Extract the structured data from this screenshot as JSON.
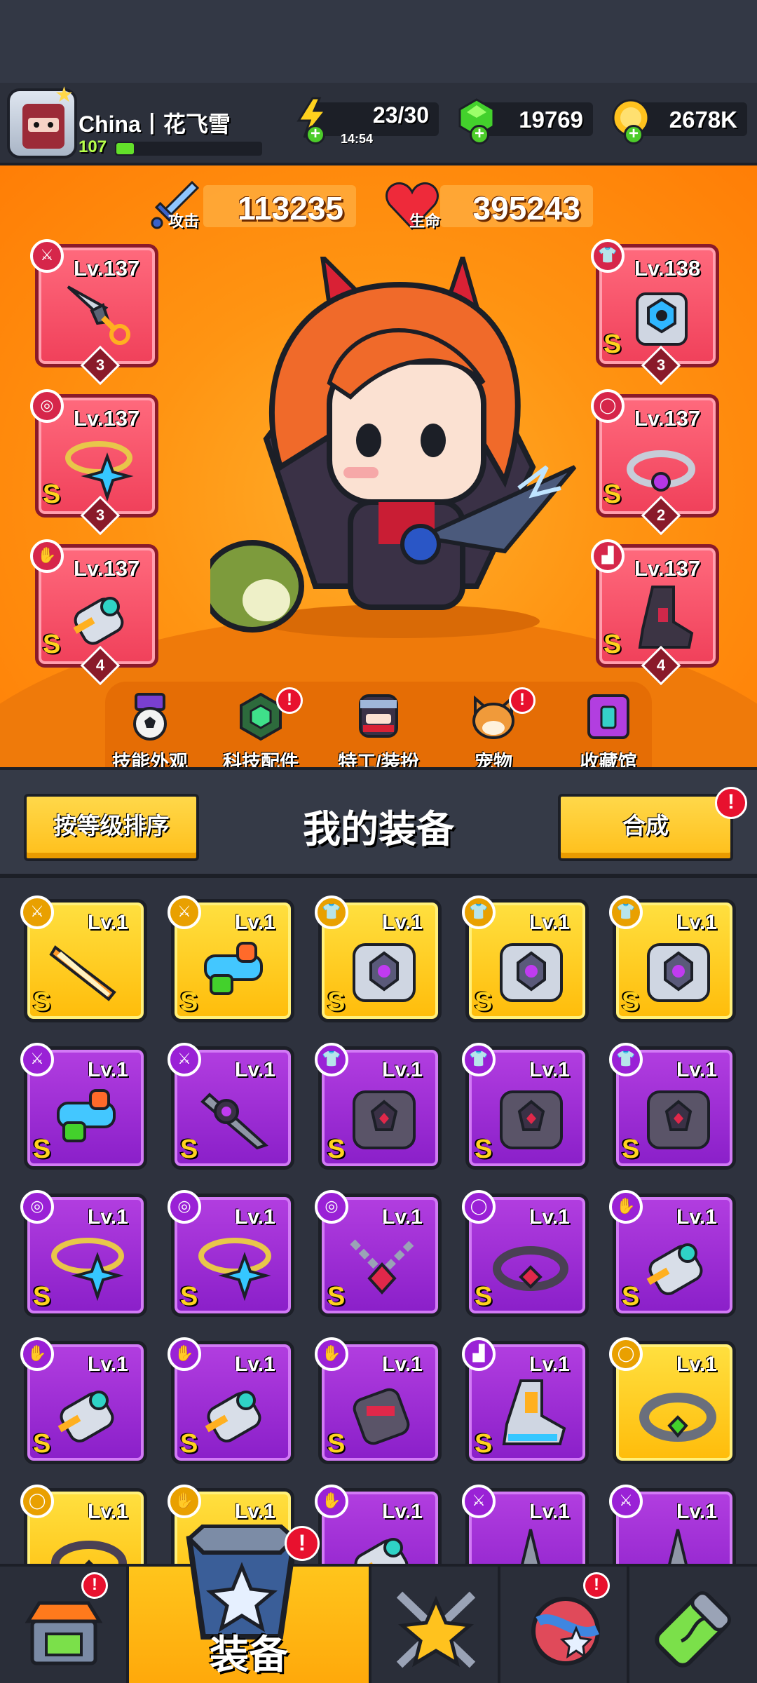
{
  "player": {
    "name": "China丨花飞雪",
    "level": "107",
    "xp_fraction": 0.12
  },
  "resources": {
    "energy": {
      "value": "23/30",
      "timer": "14:54"
    },
    "gems": {
      "value": "19769"
    },
    "coins": {
      "value": "2678K"
    }
  },
  "stats": {
    "attack": {
      "label": "攻击",
      "value": "113235"
    },
    "health": {
      "label": "生命",
      "value": "395243"
    }
  },
  "equipped": [
    {
      "slot": "weapon",
      "icon": "dagger-icon",
      "level": "Lv.137",
      "rank": "",
      "stars": "3"
    },
    {
      "slot": "necklace",
      "icon": "necklace-icon",
      "level": "Lv.137",
      "rank": "S",
      "stars": "3"
    },
    {
      "slot": "gloves",
      "icon": "glove-icon",
      "level": "Lv.137",
      "rank": "S",
      "stars": "4"
    },
    {
      "slot": "armor",
      "icon": "armor-icon",
      "level": "Lv.138",
      "rank": "S",
      "stars": "3"
    },
    {
      "slot": "belt",
      "icon": "belt-icon",
      "level": "Lv.137",
      "rank": "S",
      "stars": "2"
    },
    {
      "slot": "boots",
      "icon": "boots-icon",
      "level": "Lv.137",
      "rank": "S",
      "stars": "4"
    }
  ],
  "shortcuts": [
    {
      "label": "技能外观",
      "icon": "skill-skin-icon",
      "alert": false
    },
    {
      "label": "科技配件",
      "icon": "tech-parts-icon",
      "alert": true
    },
    {
      "label": "特工/装扮",
      "icon": "agent-outfit-icon",
      "alert": false
    },
    {
      "label": "宠物",
      "icon": "pet-icon",
      "alert": true
    },
    {
      "label": "收藏馆",
      "icon": "collection-icon",
      "alert": false
    }
  ],
  "equipment_panel": {
    "sort_label": "按等级排序",
    "title": "我的装备",
    "merge_label": "合成",
    "merge_alert": "!"
  },
  "inventory": [
    {
      "rarity": "gold",
      "type": "weapon",
      "icon": "sword-icon",
      "level": "Lv.1",
      "rank": "S"
    },
    {
      "rarity": "gold",
      "type": "weapon",
      "icon": "water-gun-icon",
      "level": "Lv.1",
      "rank": "S"
    },
    {
      "rarity": "gold",
      "type": "armor",
      "icon": "armor-icon",
      "level": "Lv.1",
      "rank": "S"
    },
    {
      "rarity": "gold",
      "type": "armor",
      "icon": "armor-icon",
      "level": "Lv.1",
      "rank": "S"
    },
    {
      "rarity": "gold",
      "type": "armor",
      "icon": "armor-icon",
      "level": "Lv.1",
      "rank": "S"
    },
    {
      "rarity": "purple",
      "type": "weapon",
      "icon": "water-gun-icon",
      "level": "Lv.1",
      "rank": "S"
    },
    {
      "rarity": "purple",
      "type": "weapon",
      "icon": "spiked-blade-icon",
      "level": "Lv.1",
      "rank": "S"
    },
    {
      "rarity": "purple",
      "type": "armor",
      "icon": "dark-armor-icon",
      "level": "Lv.1",
      "rank": "S"
    },
    {
      "rarity": "purple",
      "type": "armor",
      "icon": "dark-armor-icon",
      "level": "Lv.1",
      "rank": "S"
    },
    {
      "rarity": "purple",
      "type": "armor",
      "icon": "dark-armor-icon",
      "level": "Lv.1",
      "rank": "S"
    },
    {
      "rarity": "purple",
      "type": "necklace",
      "icon": "star-necklace-icon",
      "level": "Lv.1",
      "rank": "S"
    },
    {
      "rarity": "purple",
      "type": "necklace",
      "icon": "star-necklace-icon",
      "level": "Lv.1",
      "rank": "S"
    },
    {
      "rarity": "purple",
      "type": "necklace",
      "icon": "chain-necklace-icon",
      "level": "Lv.1",
      "rank": "S"
    },
    {
      "rarity": "purple",
      "type": "belt",
      "icon": "belt-icon",
      "level": "Lv.1",
      "rank": "S"
    },
    {
      "rarity": "purple",
      "type": "gloves",
      "icon": "glove-icon",
      "level": "Lv.1",
      "rank": "S"
    },
    {
      "rarity": "purple",
      "type": "gloves",
      "icon": "glove-icon",
      "level": "Lv.1",
      "rank": "S"
    },
    {
      "rarity": "purple",
      "type": "gloves",
      "icon": "glove-icon",
      "level": "Lv.1",
      "rank": "S"
    },
    {
      "rarity": "purple",
      "type": "gloves",
      "icon": "dark-glove-icon",
      "level": "Lv.1",
      "rank": "S"
    },
    {
      "rarity": "purple",
      "type": "boots",
      "icon": "boots-icon",
      "level": "Lv.1",
      "rank": "S"
    },
    {
      "rarity": "gold",
      "type": "belt",
      "icon": "ring-belt-icon",
      "level": "Lv.1",
      "rank": ""
    },
    {
      "rarity": "gold",
      "type": "belt",
      "icon": "belt-icon",
      "level": "Lv.1",
      "rank": ""
    },
    {
      "rarity": "gold",
      "type": "gloves",
      "icon": "glove-icon",
      "level": "Lv.1",
      "rank": ""
    },
    {
      "rarity": "purple",
      "type": "gloves",
      "icon": "glove-icon",
      "level": "Lv.1",
      "rank": ""
    },
    {
      "rarity": "purple",
      "type": "weapon",
      "icon": "dagger-icon",
      "level": "Lv.1",
      "rank": ""
    },
    {
      "rarity": "purple",
      "type": "weapon",
      "icon": "dagger-icon",
      "level": "Lv.1",
      "rank": ""
    }
  ],
  "bottom_nav": [
    {
      "name": "shop",
      "icon": "shop-icon",
      "label": "",
      "alert": true,
      "active": false
    },
    {
      "name": "equipment",
      "icon": "equipment-icon",
      "label": "装备",
      "alert": true,
      "active": true
    },
    {
      "name": "battle",
      "icon": "battle-star-icon",
      "label": "",
      "alert": false,
      "active": false
    },
    {
      "name": "world",
      "icon": "planet-icon",
      "label": "",
      "alert": true,
      "active": false
    },
    {
      "name": "lab",
      "icon": "dna-capsule-icon",
      "label": "",
      "alert": false,
      "active": false
    }
  ]
}
